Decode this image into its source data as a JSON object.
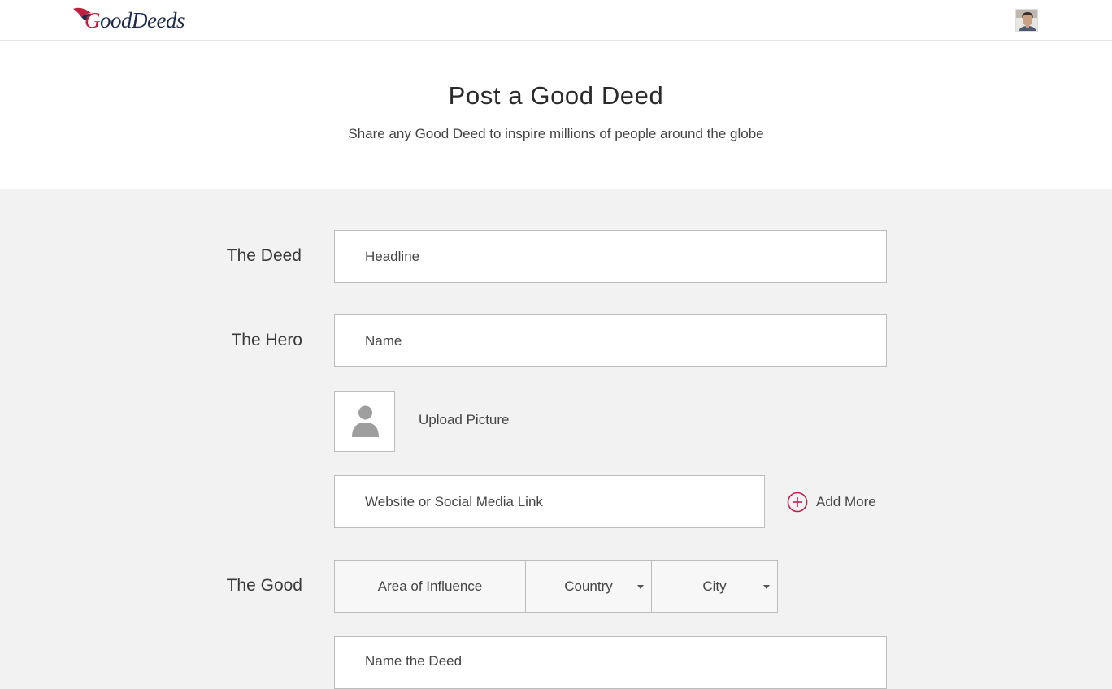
{
  "header": {
    "brand_first": "G",
    "brand_rest": "oodDeeds",
    "logo_icon": "bird-logo-icon",
    "avatar_icon": "user-avatar"
  },
  "hero": {
    "title": "Post a Good Deed",
    "subtitle": "Share any Good Deed to inspire millions of people around the globe"
  },
  "form": {
    "deed": {
      "label": "The Deed",
      "headline_placeholder": "Headline"
    },
    "hero": {
      "label": "The Hero",
      "name_placeholder": "Name",
      "upload_label": "Upload Picture",
      "upload_icon": "person-placeholder-icon",
      "link_placeholder": "Website or Social Media Link",
      "add_more_label": "Add More",
      "add_more_icon": "plus-circle-icon"
    },
    "good": {
      "label": "The Good",
      "area_label": "Area of Influence",
      "country_label": "Country",
      "city_label": "City",
      "next_placeholder": "Name the Deed"
    }
  },
  "colors": {
    "brand_red": "#c0203f",
    "brand_navy": "#1f2a4a",
    "accent_plus": "#c0204d",
    "page_bg": "#f2f2f2",
    "field_border": "#bdbdbd"
  }
}
